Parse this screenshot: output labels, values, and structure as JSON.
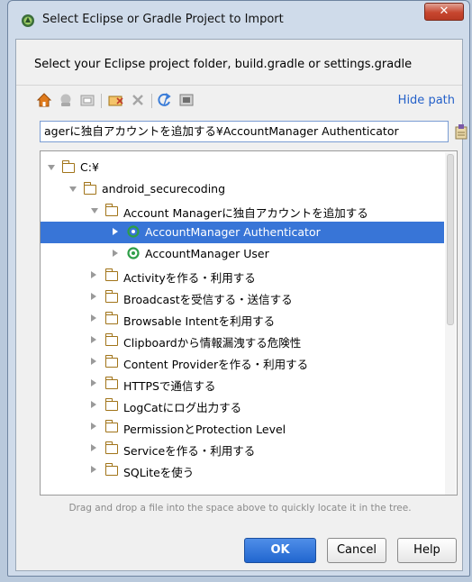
{
  "window": {
    "title": "Select Eclipse or Gradle Project to Import",
    "close_symbol": "✕"
  },
  "instruction": "Select your Eclipse project folder, build.gradle or settings.gradle",
  "toolbar": {
    "icons": [
      "home-icon",
      "project-icon",
      "module-folder-icon",
      "new-folder-icon",
      "delete-icon",
      "refresh-icon",
      "show-hidden-icon"
    ],
    "hide_path": "Hide path"
  },
  "path_input": {
    "value": "agerに独自アカウントを追加する¥AccountManager Authenticator"
  },
  "tree": {
    "nodes": [
      {
        "label": "C:¥",
        "depth": 0,
        "arrow": "down",
        "icon": "folder"
      },
      {
        "label": "android_securecoding",
        "depth": 1,
        "arrow": "down",
        "icon": "folder"
      },
      {
        "label": "Account Managerに独自アカウントを追加する",
        "depth": 2,
        "arrow": "down",
        "icon": "folder"
      },
      {
        "label": "AccountManager Authenticator",
        "depth": 3,
        "arrow": "right",
        "icon": "module",
        "selected": true
      },
      {
        "label": "AccountManager User",
        "depth": 3,
        "arrow": "right",
        "icon": "module"
      },
      {
        "label": "Activityを作る・利用する",
        "depth": 2,
        "arrow": "right",
        "icon": "folder"
      },
      {
        "label": "Broadcastを受信する・送信する",
        "depth": 2,
        "arrow": "right",
        "icon": "folder"
      },
      {
        "label": "Browsable Intentを利用する",
        "depth": 2,
        "arrow": "right",
        "icon": "folder"
      },
      {
        "label": "Clipboardから情報漏洩する危険性",
        "depth": 2,
        "arrow": "right",
        "icon": "folder"
      },
      {
        "label": "Content Providerを作る・利用する",
        "depth": 2,
        "arrow": "right",
        "icon": "folder"
      },
      {
        "label": "HTTPSで通信する",
        "depth": 2,
        "arrow": "right",
        "icon": "folder"
      },
      {
        "label": "LogCatにログ出力する",
        "depth": 2,
        "arrow": "right",
        "icon": "folder"
      },
      {
        "label": "PermissionとProtection Level",
        "depth": 2,
        "arrow": "right",
        "icon": "folder"
      },
      {
        "label": "Serviceを作る・利用する",
        "depth": 2,
        "arrow": "right",
        "icon": "folder"
      },
      {
        "label": "SQLiteを使う",
        "depth": 2,
        "arrow": "right",
        "icon": "folder"
      }
    ]
  },
  "hint": "Drag and drop a file into the space above to quickly locate it in the tree.",
  "buttons": {
    "ok": "OK",
    "cancel": "Cancel",
    "help": "Help"
  },
  "colors": {
    "selection": "#3875d7",
    "accent": "#2166cf",
    "folder": "#a17419",
    "module": "#2e9e48"
  }
}
